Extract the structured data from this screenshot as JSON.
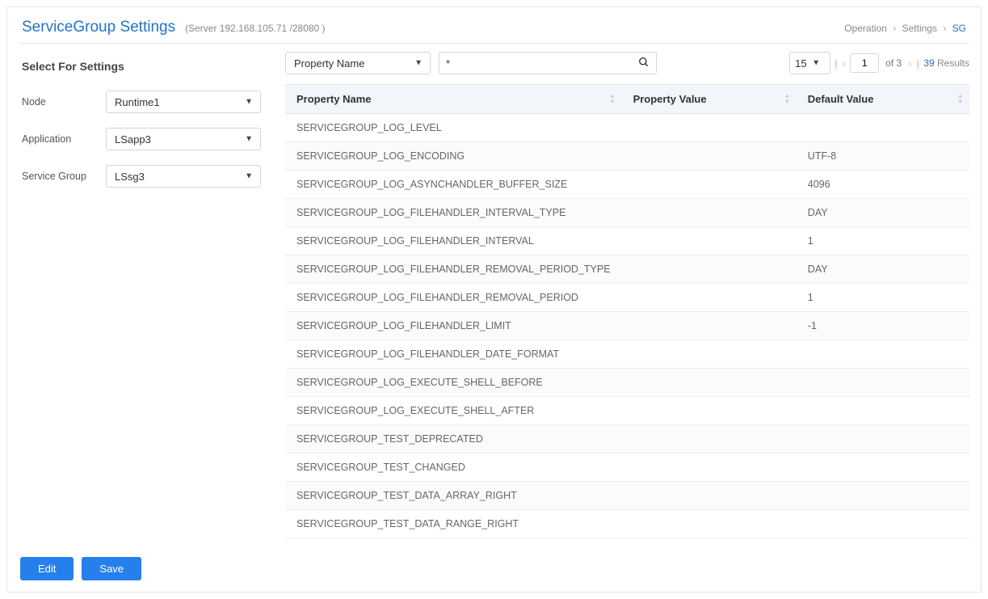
{
  "header": {
    "title": "ServiceGroup Settings",
    "server": "(Server 192.168.105.71 /28080 )",
    "breadcrumb": [
      "Operation",
      "Settings",
      "SG"
    ]
  },
  "sidebar": {
    "heading": "Select For Settings",
    "fields": {
      "node": {
        "label": "Node",
        "value": "Runtime1"
      },
      "application": {
        "label": "Application",
        "value": "LSapp3"
      },
      "group": {
        "label": "Service Group",
        "value": "LSsg3"
      }
    },
    "buttons": {
      "edit": "Edit",
      "save": "Save"
    }
  },
  "toolbar": {
    "filter_by": "Property Name",
    "search_value": "*",
    "page_size": "15",
    "page": "1",
    "of_label": "of",
    "total_pages": "3",
    "results_count": "39",
    "results_label": "Results"
  },
  "table": {
    "columns": [
      "Property Name",
      "Property Value",
      "Default Value"
    ],
    "rows": [
      {
        "name": "SERVICEGROUP_LOG_LEVEL",
        "value": "",
        "def": ""
      },
      {
        "name": "SERVICEGROUP_LOG_ENCODING",
        "value": "",
        "def": "UTF-8"
      },
      {
        "name": "SERVICEGROUP_LOG_ASYNCHANDLER_BUFFER_SIZE",
        "value": "",
        "def": "4096"
      },
      {
        "name": "SERVICEGROUP_LOG_FILEHANDLER_INTERVAL_TYPE",
        "value": "",
        "def": "DAY"
      },
      {
        "name": "SERVICEGROUP_LOG_FILEHANDLER_INTERVAL",
        "value": "",
        "def": "1"
      },
      {
        "name": "SERVICEGROUP_LOG_FILEHANDLER_REMOVAL_PERIOD_TYPE",
        "value": "",
        "def": "DAY"
      },
      {
        "name": "SERVICEGROUP_LOG_FILEHANDLER_REMOVAL_PERIOD",
        "value": "",
        "def": "1"
      },
      {
        "name": "SERVICEGROUP_LOG_FILEHANDLER_LIMIT",
        "value": "",
        "def": "-1"
      },
      {
        "name": "SERVICEGROUP_LOG_FILEHANDLER_DATE_FORMAT",
        "value": "",
        "def": ""
      },
      {
        "name": "SERVICEGROUP_LOG_EXECUTE_SHELL_BEFORE",
        "value": "",
        "def": ""
      },
      {
        "name": "SERVICEGROUP_LOG_EXECUTE_SHELL_AFTER",
        "value": "",
        "def": ""
      },
      {
        "name": "SERVICEGROUP_TEST_DEPRECATED",
        "value": "",
        "def": ""
      },
      {
        "name": "SERVICEGROUP_TEST_CHANGED",
        "value": "",
        "def": ""
      },
      {
        "name": "SERVICEGROUP_TEST_DATA_ARRAY_RIGHT",
        "value": "",
        "def": ""
      },
      {
        "name": "SERVICEGROUP_TEST_DATA_RANGE_RIGHT",
        "value": "",
        "def": ""
      }
    ]
  }
}
